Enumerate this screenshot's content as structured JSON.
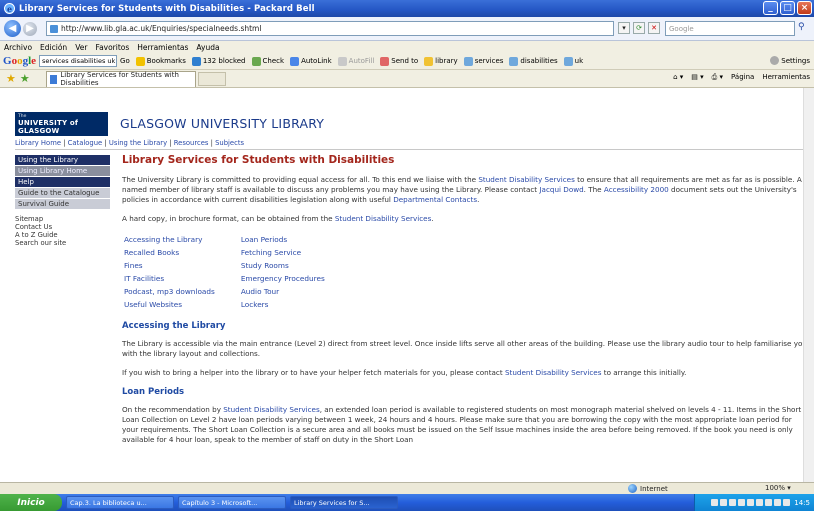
{
  "window": {
    "title": "Library Services for Students with Disabilities - Packard Bell"
  },
  "address_bar": {
    "url": "http://www.lib.gla.ac.uk/Enquiries/specialneeds.shtml",
    "search_placeholder": "Google"
  },
  "menu": [
    "Archivo",
    "Edición",
    "Ver",
    "Favoritos",
    "Herramientas",
    "Ayuda"
  ],
  "google_toolbar": {
    "search_value": "services disabilities uk",
    "go_label": "Go",
    "items": [
      "Bookmarks",
      "132 blocked",
      "Check",
      "AutoLink",
      "AutoFill",
      "Send to",
      "library",
      "services",
      "disabilities",
      "uk"
    ],
    "settings": "Settings"
  },
  "tab": {
    "label": "Library Services for Students with Disabilities"
  },
  "command_bar": {
    "page": "Página",
    "tools": "Herramientas"
  },
  "site": {
    "logo_small": "The",
    "logo_text": "UNIVERSITY of GLASGOW",
    "library_title": "GLASGOW UNIVERSITY LIBRARY",
    "breadcrumb": [
      "Library Home",
      "Catalogue",
      "Using the Library",
      "Resources",
      "Subjects"
    ]
  },
  "sidebar": {
    "items": [
      "Using the Library",
      "Using Library Home",
      "Help",
      "Guide to the Catalogue",
      "Survival Guide"
    ],
    "links": [
      "Sitemap",
      "Contact Us",
      "A to Z Guide",
      "Search our site"
    ]
  },
  "page": {
    "title": "Library Services for Students with Disabilities",
    "intro": {
      "t1": "The University Library is committed to providing equal access for all. To this end we liaise with the ",
      "l1": "Student Disability Services",
      "t2": " to ensure that all requirements are met as far as is possible. A named member of library staff is available to discuss any problems you may have using the Library. Please contact ",
      "l2": "Jacqui Dowd",
      "t3": ". The ",
      "l3": "Accessibility 2000",
      "t4": " document sets out the University's policies in accordance with current disabilities legislation along with useful ",
      "l4": "Departmental Contacts",
      "t5": "."
    },
    "brochure": {
      "t1": "A hard copy, in brochure format, can be obtained from the ",
      "l1": "Student Disability Services",
      "t2": "."
    },
    "links_col1": [
      "Accessing the Library",
      "Recalled Books",
      "Fines",
      "IT Facilities",
      "Podcast, mp3 downloads",
      "Useful Websites"
    ],
    "links_col2": [
      "Loan Periods",
      "Fetching Service",
      "Study Rooms",
      "Emergency Procedures",
      "Audio Tour",
      "Lockers"
    ],
    "accessing": {
      "heading": "Accessing the Library",
      "p1": "The Library is accessible via the main entrance (Level 2) direct from street level. Once inside lifts serve all other areas of the building. Please use the library audio tour to help familiarise you with the library layout and collections.",
      "p2_t1": "If you wish to bring a helper into the library or to have your helper fetch materials for you, please contact ",
      "p2_l1": "Student Disability Services",
      "p2_t2": " to arrange this initially."
    },
    "loan": {
      "heading": "Loan Periods",
      "t1": "On the recommendation by ",
      "l1": "Student Disability Services",
      "t2": ", an extended loan period is available to registered students on most monograph material shelved on levels 4 - 11. Items in the Short Loan Collection on Level 2 have loan periods varying between 1 week, 24 hours and 4 hours. Please make sure that you are borrowing the copy with the most appropriate loan period for your requirements. The Short Loan Collection is a secure area and all books must be issued on the Self Issue machines inside the area before being removed. If the book you need is only available for 4 hour loan, speak to the member of staff on duty in the Short Loan"
    }
  },
  "status_bar": {
    "zone": "Internet",
    "zoom": "100%"
  },
  "taskbar": {
    "start": "Inicio",
    "buttons": [
      "Cap.3. La biblioteca u...",
      "Capítulo 3 - Microsoft...",
      "Library Services for S..."
    ],
    "clock": "14:5"
  }
}
